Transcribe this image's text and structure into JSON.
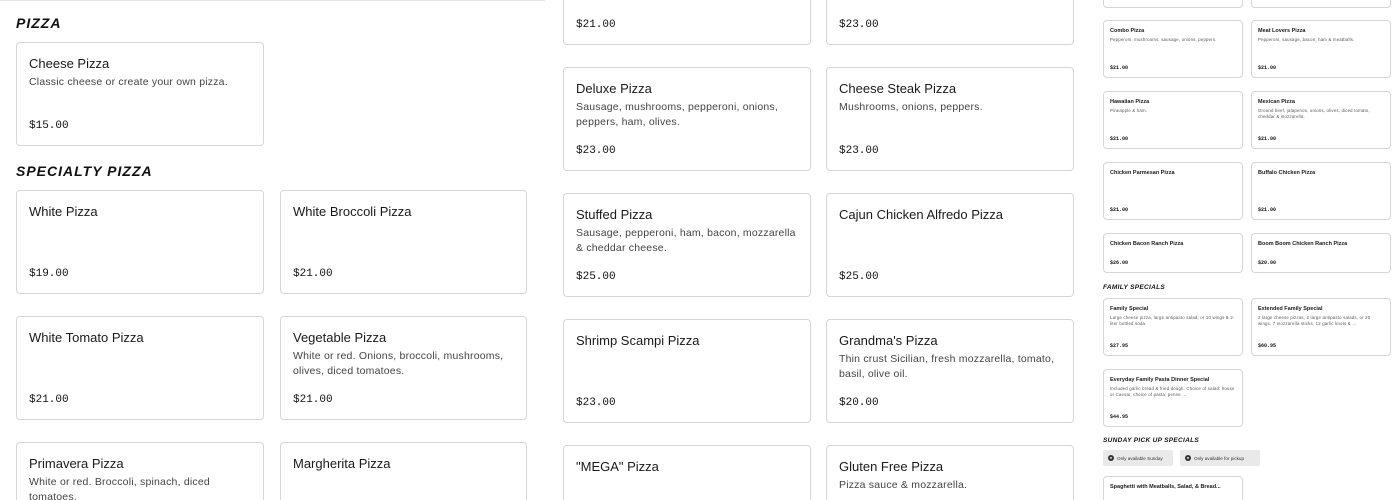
{
  "col1": {
    "sections": [
      {
        "title": "pizza"
      },
      {
        "title": "specialty pizza"
      }
    ],
    "cards": [
      {
        "name": "Cheese Pizza",
        "desc": "Classic cheese or create your own pizza.",
        "price": "$15.00"
      },
      {
        "name": "White Pizza",
        "desc": "",
        "price": "$19.00"
      },
      {
        "name": "White Broccoli Pizza",
        "desc": "",
        "price": "$21.00"
      },
      {
        "name": "White Tomato Pizza",
        "desc": "",
        "price": "$21.00"
      },
      {
        "name": "Vegetable Pizza",
        "desc": "White or red. Onions, broccoli, mushrooms, olives, diced tomatoes.",
        "price": "$21.00"
      },
      {
        "name": "Primavera Pizza",
        "desc": "White or red. Broccoli, spinach, diced tomatoes.",
        "price": ""
      },
      {
        "name": "Margherita Pizza",
        "desc": "",
        "price": ""
      }
    ]
  },
  "col2": {
    "cards": [
      {
        "name": "",
        "desc": "",
        "price": "$21.00"
      },
      {
        "name": "",
        "desc": "",
        "price": "$23.00"
      },
      {
        "name": "Deluxe Pizza",
        "desc": "Sausage, mushrooms, pepperoni, onions, peppers, ham, olives.",
        "price": "$23.00"
      },
      {
        "name": "Cheese Steak Pizza",
        "desc": "Mushrooms, onions, peppers.",
        "price": "$23.00"
      },
      {
        "name": "Stuffed Pizza",
        "desc": "Sausage, pepperoni, ham, bacon, mozzarella & cheddar cheese.",
        "price": "$25.00"
      },
      {
        "name": "Cajun Chicken Alfredo Pizza",
        "desc": "",
        "price": "$25.00"
      },
      {
        "name": "Shrimp Scampi Pizza",
        "desc": "",
        "price": "$23.00"
      },
      {
        "name": "Grandma's Pizza",
        "desc": "Thin crust Sicilian, fresh mozzarella, tomato, basil, olive oil.",
        "price": "$20.00"
      },
      {
        "name": "\"MEGA\" Pizza",
        "desc": "",
        "price": ""
      },
      {
        "name": "Gluten Free Pizza",
        "desc": "Pizza sauce & mozzarella.",
        "price": ""
      }
    ]
  },
  "col3": {
    "cards": [
      {
        "name": "Combo Pizza",
        "desc": "Pepperoni, mushrooms, sausage, onions, peppers.",
        "price": "$21.00"
      },
      {
        "name": "Meat Lovers Pizza",
        "desc": "Pepperoni, sausage, bacon, ham & meatballs.",
        "price": "$21.00"
      },
      {
        "name": "Hawaiian Pizza",
        "desc": "Pineapple & ham.",
        "price": "$21.00"
      },
      {
        "name": "Mexican Pizza",
        "desc": "Ground beef, jalapenos, onions, olives, diced tomato, cheddar & mozzarella.",
        "price": "$21.00"
      },
      {
        "name": "Chicken Parmesan Pizza",
        "desc": "",
        "price": "$21.00"
      },
      {
        "name": "Buffalo Chicken Pizza",
        "desc": "",
        "price": "$21.00"
      },
      {
        "name": "Chicken Bacon Ranch Pizza",
        "desc": "",
        "price": "$26.00"
      },
      {
        "name": "Boom Boom Chicken Ranch Pizza",
        "desc": "",
        "price": "$20.00"
      },
      {
        "name": "Family Special",
        "desc": "Large cheese pizza, large antipasto salad, or 10 wings & 2-liter bottled soda.",
        "price": "$27.95"
      },
      {
        "name": "Extended Family Special",
        "desc": "2 large cheese pizzas, 2 large antipasto salads, or 20 wings, 7 mozzarella sticks, 12 garlic knots & ...",
        "price": "$60.95"
      },
      {
        "name": "Everyday Family Pasta Dinner Special",
        "desc": "Included garlic bread & fried dough. Choice of salad: house or Caesar, choice of pasta: penne ...",
        "price": "$44.95"
      },
      {
        "name": "Spaghetti with Meatballs, Salad, & Bread...",
        "desc": "",
        "price": ""
      }
    ],
    "titles": {
      "family": "family specials",
      "sunday": "sunday pick up specials"
    },
    "badges": [
      {
        "label": "Only available Sunday"
      },
      {
        "label": "Only available for pickup"
      }
    ]
  }
}
